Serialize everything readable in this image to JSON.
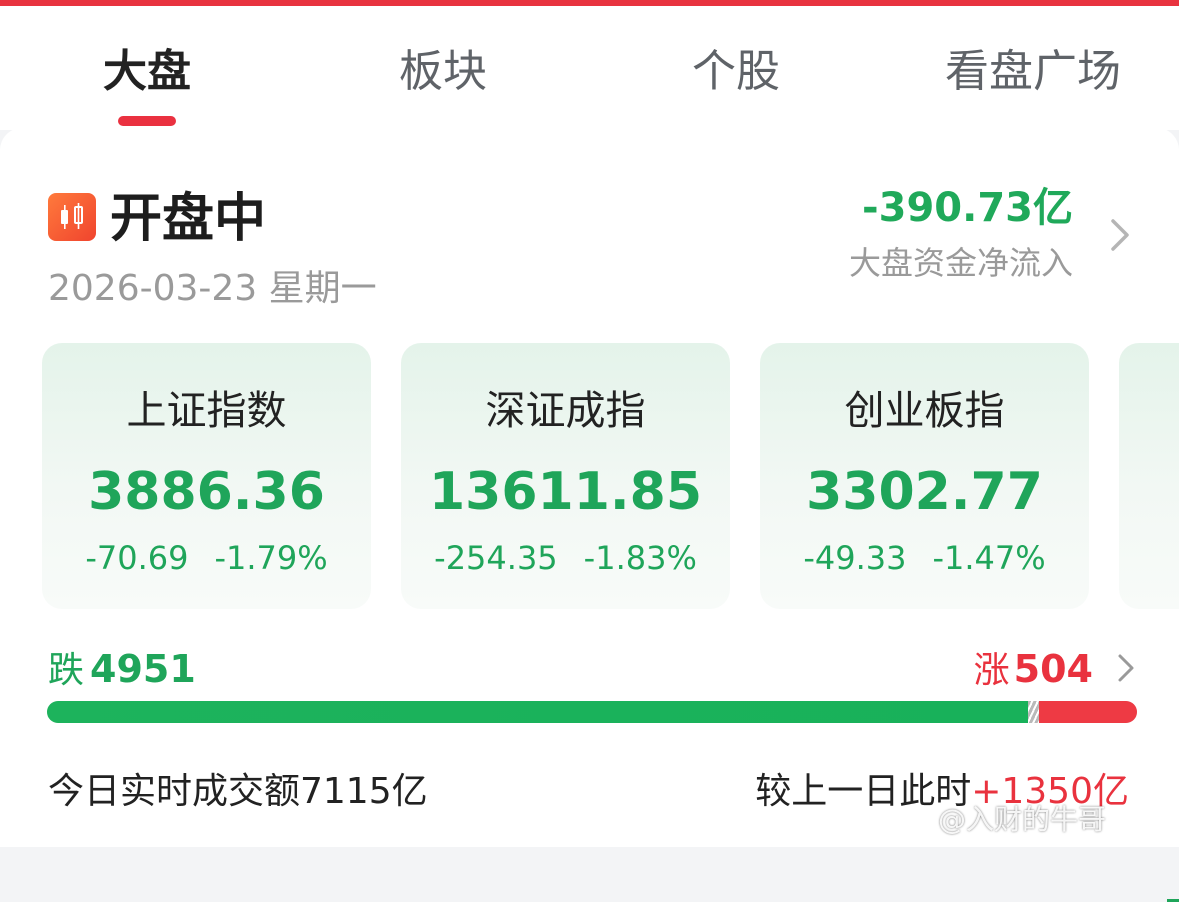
{
  "tabs": [
    {
      "label": "大盘",
      "active": true
    },
    {
      "label": "板块",
      "active": false
    },
    {
      "label": "个股",
      "active": false
    },
    {
      "label": "看盘广场",
      "active": false
    }
  ],
  "market": {
    "status": "开盘中",
    "status_icon": "candlestick-icon",
    "date": "2026-03-23 星期一",
    "net_flow_value": "-390.73亿",
    "net_flow_label": "大盘资金净流入"
  },
  "indices": [
    {
      "name": "上证指数",
      "value": "3886.36",
      "change": "-70.69",
      "change_pct": "-1.79%"
    },
    {
      "name": "深证成指",
      "value": "13611.85",
      "change": "-254.35",
      "change_pct": "-1.83%"
    },
    {
      "name": "创业板指",
      "value": "3302.77",
      "change": "-49.33",
      "change_pct": "-1.47%"
    }
  ],
  "breadth": {
    "down_label": "跌",
    "down_count": "4951",
    "up_label": "涨",
    "up_count": "504",
    "down_fraction": 0.9,
    "up_fraction": 0.09
  },
  "turnover": {
    "label": "今日实时成交额7115亿",
    "compare_prefix": "较上一日此时",
    "compare_delta": "+1350亿"
  },
  "watermark": "@入财的牛哥",
  "colors": {
    "accent_red": "#e9323e",
    "down_green": "#1fa55a"
  }
}
